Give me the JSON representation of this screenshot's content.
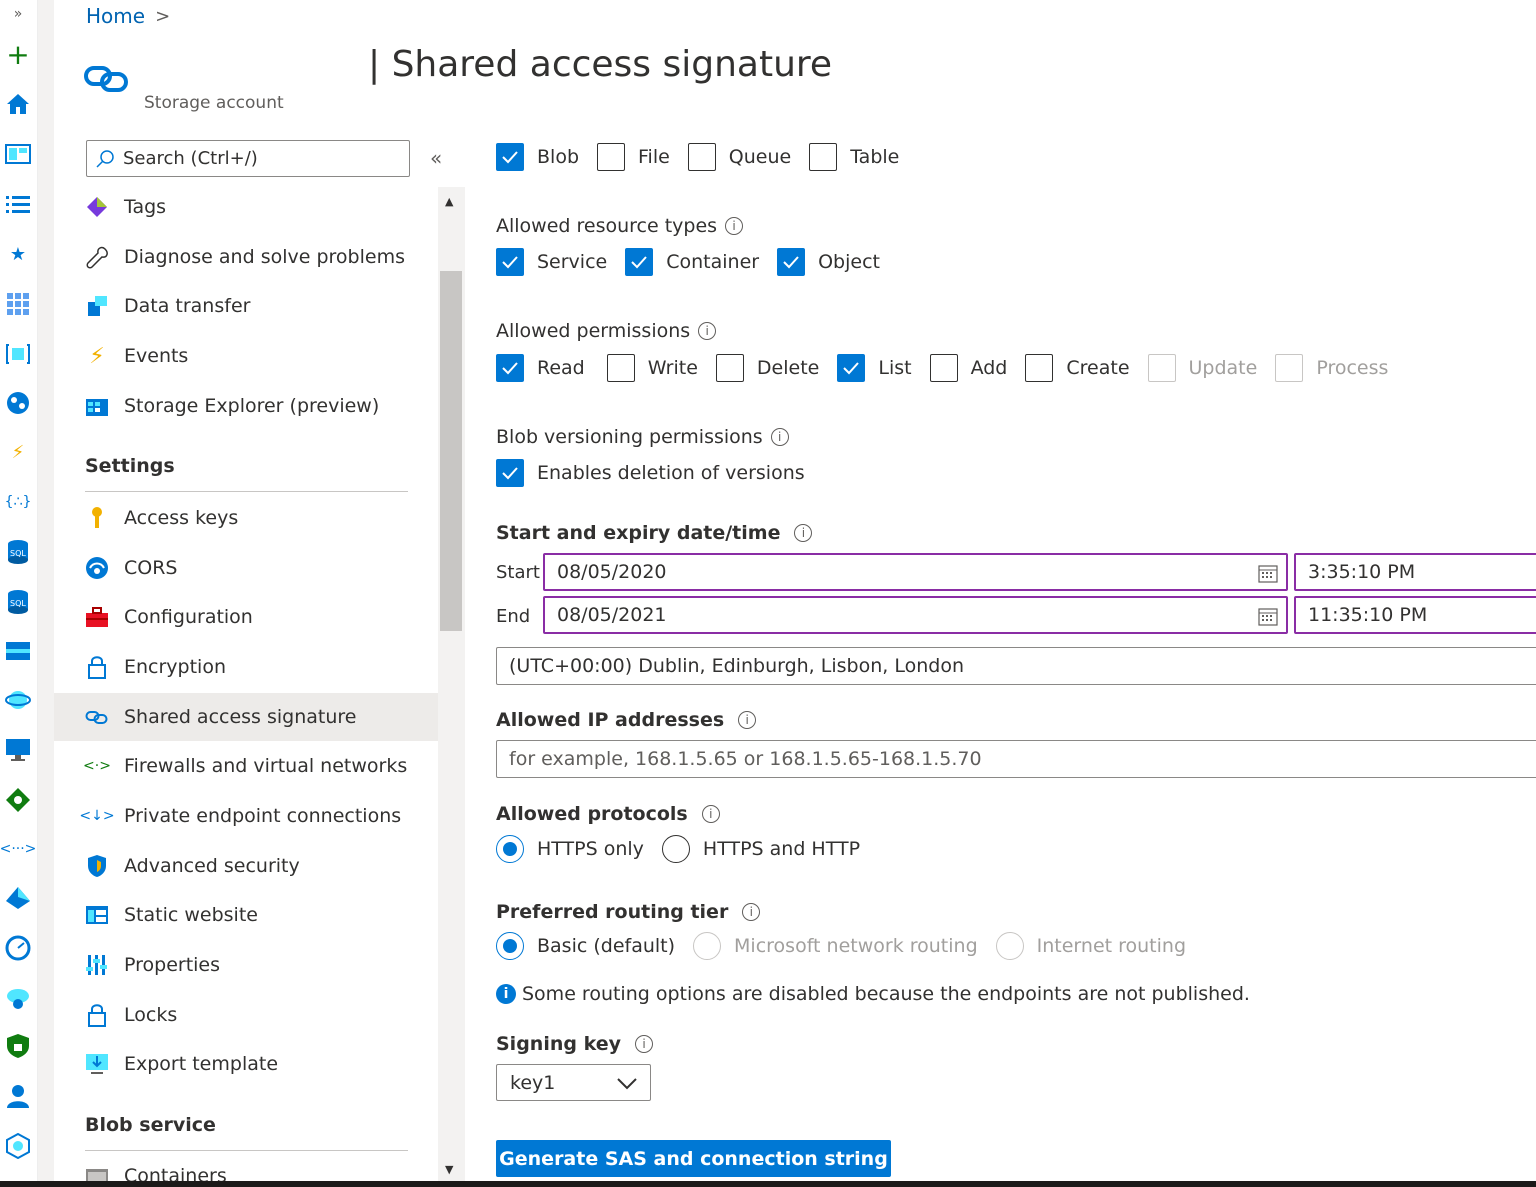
{
  "breadcrumb": {
    "home": "Home",
    "chevron": ">"
  },
  "header": {
    "title": "| Shared access signature",
    "subtitle": "Storage account"
  },
  "menu": {
    "search_placeholder": "Search (Ctrl+/)",
    "items": [
      {
        "label": "Tags",
        "icon": "tag-icon"
      },
      {
        "label": "Diagnose and solve problems",
        "icon": "wrench-icon"
      },
      {
        "label": "Data transfer",
        "icon": "data-transfer-icon"
      },
      {
        "label": "Events",
        "icon": "lightning-icon"
      },
      {
        "label": "Storage Explorer (preview)",
        "icon": "storage-explorer-icon"
      }
    ],
    "settings_heading": "Settings",
    "settings_items": [
      {
        "label": "Access keys",
        "icon": "key-icon"
      },
      {
        "label": "CORS",
        "icon": "cors-icon"
      },
      {
        "label": "Configuration",
        "icon": "toolbox-icon"
      },
      {
        "label": "Encryption",
        "icon": "lock-icon"
      },
      {
        "label": "Shared access signature",
        "icon": "link-icon"
      },
      {
        "label": "Firewalls and virtual networks",
        "icon": "firewall-icon"
      },
      {
        "label": "Private endpoint connections",
        "icon": "endpoint-icon"
      },
      {
        "label": "Advanced security",
        "icon": "shield-icon"
      },
      {
        "label": "Static website",
        "icon": "website-icon"
      },
      {
        "label": "Properties",
        "icon": "properties-icon"
      },
      {
        "label": "Locks",
        "icon": "lock-icon"
      },
      {
        "label": "Export template",
        "icon": "export-icon"
      }
    ],
    "blob_heading": "Blob service",
    "blob_items": [
      {
        "label": "Containers",
        "icon": "container-icon"
      }
    ]
  },
  "services": {
    "items": [
      {
        "label": "Blob",
        "checked": true
      },
      {
        "label": "File",
        "checked": false
      },
      {
        "label": "Queue",
        "checked": false
      },
      {
        "label": "Table",
        "checked": false
      }
    ]
  },
  "resource_types": {
    "label": "Allowed resource types",
    "items": [
      {
        "label": "Service",
        "checked": true
      },
      {
        "label": "Container",
        "checked": true
      },
      {
        "label": "Object",
        "checked": true
      }
    ]
  },
  "permissions": {
    "label": "Allowed permissions",
    "items": [
      {
        "label": "Read",
        "checked": true
      },
      {
        "label": "Write",
        "checked": false
      },
      {
        "label": "Delete",
        "checked": false
      },
      {
        "label": "List",
        "checked": true
      },
      {
        "label": "Add",
        "checked": false
      },
      {
        "label": "Create",
        "checked": false
      },
      {
        "label": "Update",
        "checked": false,
        "disabled": true
      },
      {
        "label": "Process",
        "checked": false,
        "disabled": true
      }
    ]
  },
  "versioning": {
    "label": "Blob versioning permissions",
    "option": "Enables deletion of versions",
    "checked": true
  },
  "dates": {
    "label": "Start and expiry date/time",
    "start_label": "Start",
    "start_date": "08/05/2020",
    "start_time": "3:35:10 PM",
    "end_label": "End",
    "end_date": "08/05/2021",
    "end_time": "11:35:10 PM",
    "timezone": "(UTC+00:00) Dublin, Edinburgh, Lisbon, London"
  },
  "ip": {
    "label": "Allowed IP addresses",
    "placeholder": "for example, 168.1.5.65 or 168.1.5.65-168.1.5.70"
  },
  "protocols": {
    "label": "Allowed protocols",
    "options": [
      "HTTPS only",
      "HTTPS and HTTP"
    ],
    "selected": "HTTPS only"
  },
  "routing": {
    "label": "Preferred routing tier",
    "options": [
      "Basic (default)",
      "Microsoft network routing",
      "Internet routing"
    ],
    "selected": "Basic (default)",
    "note": "Some routing options are disabled because the endpoints are not published."
  },
  "signing": {
    "label": "Signing key",
    "value": "key1"
  },
  "generate_button": "Generate SAS and connection string",
  "colors": {
    "accent": "#0078d4",
    "date_border": "#8a2da5"
  }
}
